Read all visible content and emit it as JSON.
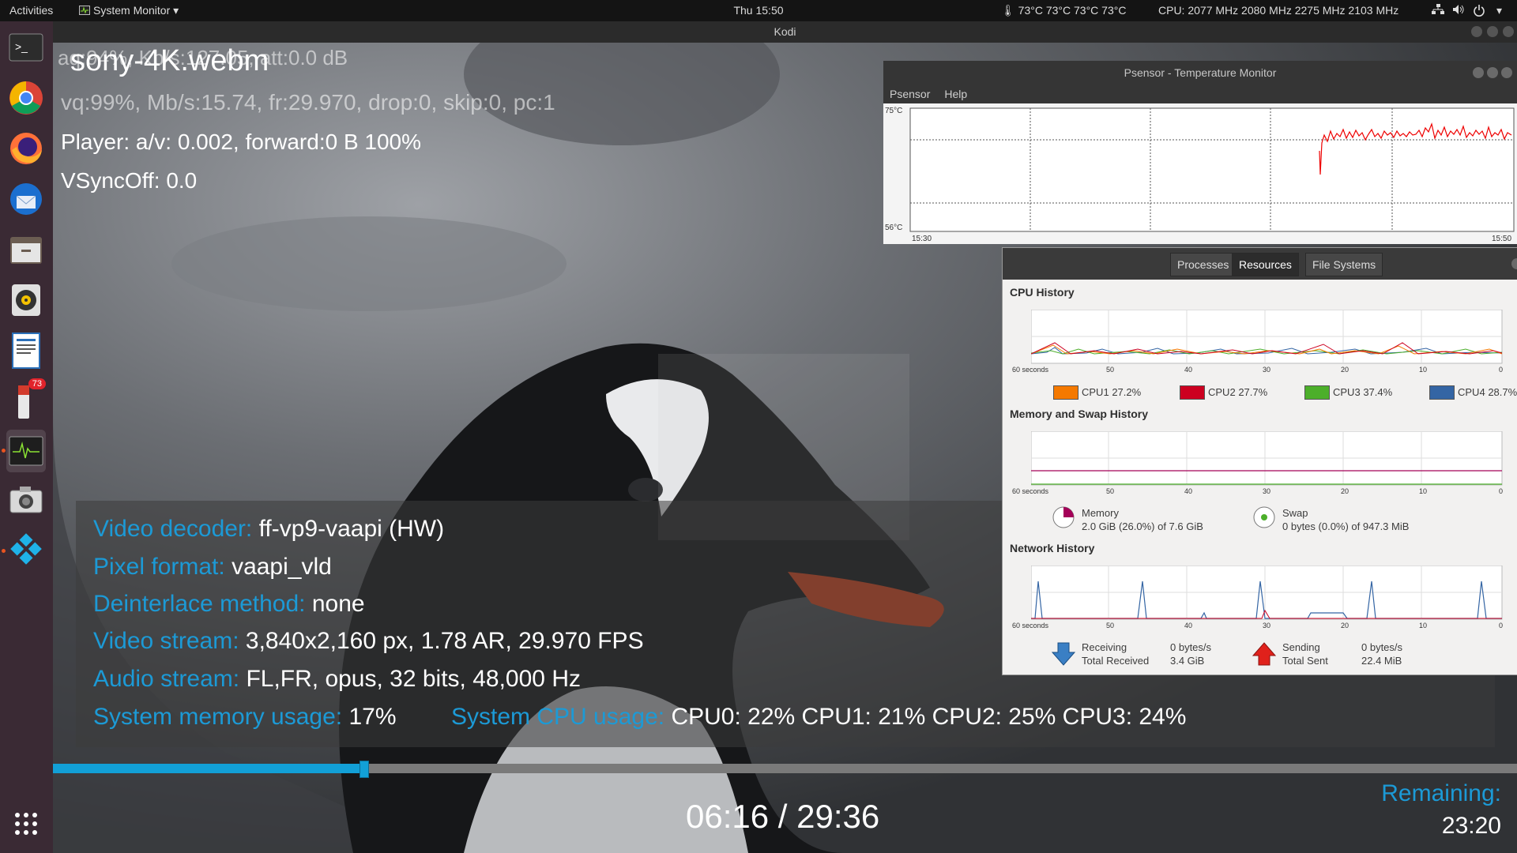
{
  "topbar": {
    "activities": "Activities",
    "app_menu": "System Monitor ▾",
    "clock": "Thu 15:50",
    "temps": "73°C 73°C 73°C 73°C",
    "cpu_freq": "CPU: 2077 MHz 2080 MHz 2275 MHz 2103 MHz"
  },
  "dock": {
    "badge_count": "73",
    "items": [
      "terminal-icon",
      "chrome-icon",
      "firefox-icon",
      "thunderbird-icon",
      "files-icon",
      "rhythmbox-icon",
      "writer-icon",
      "software-icon",
      "system-monitor-icon",
      "screenshot-icon",
      "kodi-icon"
    ]
  },
  "kodi": {
    "window_title": "Kodi",
    "file_name": "sony-4K.webm",
    "osd_faded_1": "aq:94%, Kb/s:127.05, att:0.0 dB",
    "osd_vq": "vq:99%, Mb/s:15.74, fr:29.970, drop:0, skip:0, pc:1",
    "osd_player": "Player: a/v: 0.002,  forward:0 B 100%",
    "osd_vsync": "VSyncOff: 0.0",
    "info": {
      "video_decoder_k": "Video decoder:",
      "video_decoder_v": "ff-vp9-vaapi (HW)",
      "pixel_format_k": "Pixel format:",
      "pixel_format_v": "vaapi_vld",
      "deinterlace_k": "Deinterlace method:",
      "deinterlace_v": "none",
      "video_stream_k": "Video stream:",
      "video_stream_v": "3,840x2,160 px, 1.78 AR, 29.970 FPS",
      "audio_stream_k": "Audio stream:",
      "audio_stream_v": "FL,FR, opus, 32 bits, 48,000 Hz",
      "mem_k": "System memory usage:",
      "mem_v": "17%",
      "cpu_k": "System CPU usage:",
      "cpu_v": "CPU0:  22% CPU1:  21% CPU2:  25% CPU3:  24%"
    },
    "progress_fraction": 0.212,
    "time": "06:16 / 29:36",
    "remaining_label": "Remaining:",
    "remaining_value": "23:20"
  },
  "psensor": {
    "title": "Psensor - Temperature Monitor",
    "menu": [
      "Psensor",
      "Help"
    ],
    "y_max": "75°C",
    "y_min": "56°C",
    "x_start": "15:30",
    "x_end": "15:50"
  },
  "sysmon": {
    "tabs": [
      "Processes",
      "Resources",
      "File Systems"
    ],
    "cpu_history": "CPU History",
    "mem_history": "Memory and Swap History",
    "net_history": "Network History",
    "x_ticks": [
      "60 seconds",
      "50",
      "40",
      "30",
      "20",
      "10",
      "0"
    ],
    "cpu_legend": [
      {
        "label": "CPU1",
        "value": "27.2%",
        "color": "#f57900"
      },
      {
        "label": "CPU2",
        "value": "27.7%",
        "color": "#cc0020"
      },
      {
        "label": "CPU3",
        "value": "37.4%",
        "color": "#4caf2a"
      },
      {
        "label": "CPU4",
        "value": "28.7%",
        "color": "#3465a4"
      }
    ],
    "memory_label": "Memory",
    "memory_value": "2.0 GiB (26.0%) of 7.6 GiB",
    "swap_label": "Swap",
    "swap_value": "0 bytes (0.0%) of 947.3 MiB",
    "receiving_label": "Receiving",
    "receiving_value": "0 bytes/s",
    "total_received_label": "Total Received",
    "total_received_value": "3.4 GiB",
    "sending_label": "Sending",
    "sending_value": "0 bytes/s",
    "total_sent_label": "Total Sent",
    "total_sent_value": "22.4 MiB"
  }
}
